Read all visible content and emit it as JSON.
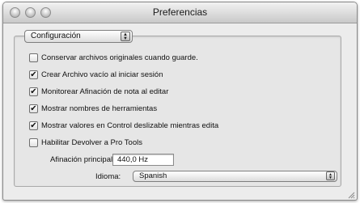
{
  "window": {
    "title": "Preferencias"
  },
  "section_popup": {
    "selected": "Configuración"
  },
  "options": [
    {
      "label": "Conservar archivos originales cuando guarde.",
      "checked": false
    },
    {
      "label": "Crear Archivo vacío al iniciar sesión",
      "checked": true
    },
    {
      "label": "Monitorear Afinación de nota al editar",
      "checked": true
    },
    {
      "label": "Mostrar nombres de herramientas",
      "checked": true
    },
    {
      "label": "Mostrar valores en Control deslizable mientras edita",
      "checked": true
    },
    {
      "label": "Habilitar Devolver a Pro Tools",
      "checked": false
    }
  ],
  "tuning": {
    "label": "Afinación principal",
    "value": "440,0 Hz"
  },
  "language": {
    "label": "Idioma:",
    "selected": "Spanish"
  },
  "glyphs": {
    "check": "✔",
    "updown": "▲▼"
  }
}
